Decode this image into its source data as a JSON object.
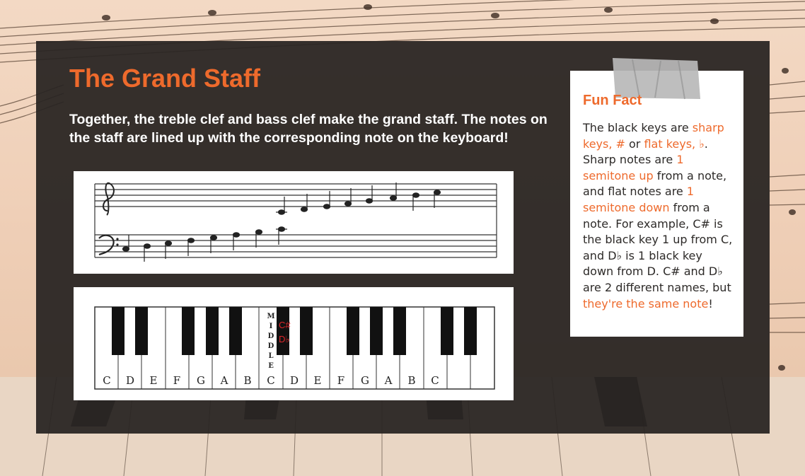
{
  "page": {
    "title": "The Grand Staff",
    "intro": "Together, the treble clef and bass clef make the grand staff. The notes on the staff are lined up with the corresponding note on the keyboard!"
  },
  "keyboard": {
    "white_keys": [
      "C",
      "D",
      "E",
      "F",
      "G",
      "A",
      "B",
      "C",
      "D",
      "E",
      "F",
      "G",
      "A",
      "B",
      "C",
      "",
      ""
    ],
    "middle_label": [
      "M",
      "I",
      "D",
      "D",
      "L",
      "E"
    ],
    "sharp_label": "C#",
    "flat_label": "D♭"
  },
  "fun_fact": {
    "title": "Fun Fact",
    "t1": "The black keys are ",
    "h1": "sharp keys, #",
    "t2": " or ",
    "h2": "flat keys, ♭",
    "t3": ". Sharp notes are ",
    "h3": "1 semitone up",
    "t4": " from a note, and flat notes are ",
    "h4": "1 semitone down",
    "t5": " from a note. For example, C# is the black key 1 up from C, and D♭ is 1 black key down from D. C# and D♭ are 2 different names, but ",
    "h5": "they're the same note",
    "t6": "!"
  },
  "colors": {
    "accent": "#ee6a2c",
    "panel": "#282422",
    "sharp_label": "#e0262a"
  }
}
